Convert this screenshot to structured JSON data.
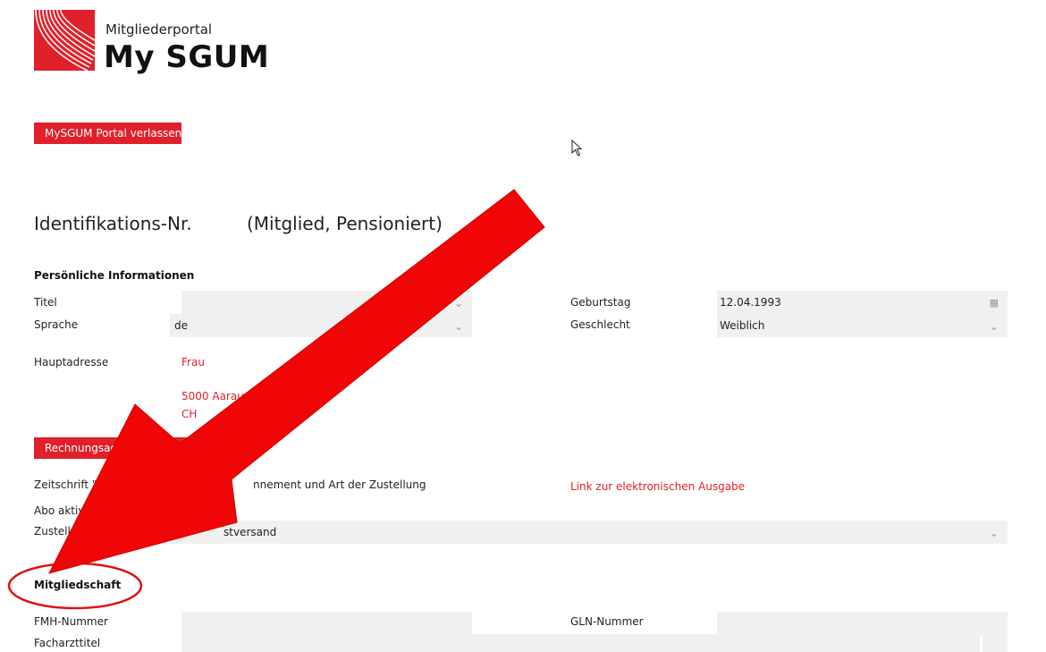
{
  "logo": {
    "subtitle": "Mitgliederportal",
    "title": "My SGUM"
  },
  "buttons": {
    "leave": "MySGUM Portal verlassen",
    "billing": "Rechnungsadresse erstellen"
  },
  "heading": {
    "ident": "Identifikations-Nr.",
    "status": "(Mitglied, Pensioniert)"
  },
  "personal": {
    "section_title": "Persönliche Informationen",
    "titel_label": "Titel",
    "titel_value": "",
    "sprache_label": "Sprache",
    "sprache_value": "de",
    "geburtstag_label": "Geburtstag",
    "geburtstag_value": "12.04.1993",
    "geschlecht_label": "Geschlecht",
    "geschlecht_value": "Weiblich",
    "hauptadresse_label": "Hauptadresse",
    "address_line1": "Frau",
    "address_city": "5000 Aarau",
    "address_country": "CH"
  },
  "journal": {
    "label_left": "Zeitschrift \"Ultraso",
    "label_mid": "den",
    "label_right": "nnement und Art der Zustellung",
    "link": "Link zur elektronischen Ausgabe",
    "abo_label": "Abo aktiv",
    "zustellung_label": "Zustellung",
    "zustellung_value": "stversand"
  },
  "membership": {
    "section_title": "Mitgliedschaft",
    "fmh_label": "FMH-Nummer",
    "fmh_value": "",
    "gln_label": "GLN-Nummer",
    "gln_value": "",
    "facharzt_label": "Facharzttitel",
    "facharzt_value": ""
  },
  "colors": {
    "brand_red": "#e0202a",
    "field_bg": "#f0f0f0"
  },
  "icons": {
    "calendar": "calendar-icon",
    "chevron": "chevron-down-icon",
    "cursor": "mouse-pointer-icon"
  }
}
